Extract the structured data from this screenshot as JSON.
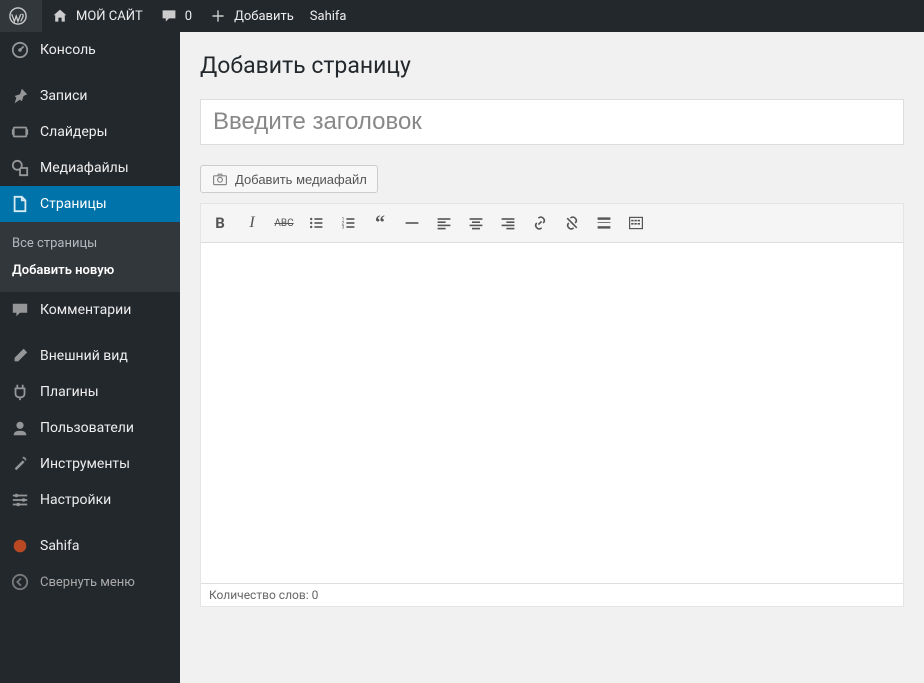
{
  "topbar": {
    "site_name": "МОЙ САЙТ",
    "comments_count": "0",
    "add_label": "Добавить",
    "theme_label": "Sahifa"
  },
  "sidebar": {
    "items": [
      {
        "label": "Консоль",
        "icon": "dashboard-icon"
      },
      {
        "label": "Записи",
        "icon": "pin-icon"
      },
      {
        "label": "Слайдеры",
        "icon": "slides-icon"
      },
      {
        "label": "Медиафайлы",
        "icon": "media-icon"
      },
      {
        "label": "Страницы",
        "icon": "page-icon",
        "active": true
      },
      {
        "label": "Комментарии",
        "icon": "comment-icon"
      },
      {
        "label": "Внешний вид",
        "icon": "brush-icon"
      },
      {
        "label": "Плагины",
        "icon": "plug-icon"
      },
      {
        "label": "Пользователи",
        "icon": "users-icon"
      },
      {
        "label": "Инструменты",
        "icon": "tools-icon"
      },
      {
        "label": "Настройки",
        "icon": "sliders-icon"
      },
      {
        "label": "Sahifa",
        "icon": "theme-icon"
      }
    ],
    "submenu": {
      "all": "Все страницы",
      "add": "Добавить новую"
    },
    "collapse": "Свернуть меню"
  },
  "main": {
    "heading": "Добавить страницу",
    "title_placeholder": "Введите заголовок",
    "media_button": "Добавить медиафайл",
    "word_count_label": "Количество слов: 0"
  },
  "toolbar_buttons": [
    "bold",
    "italic",
    "strike",
    "ul",
    "ol",
    "quote",
    "hr",
    "align-left",
    "align-center",
    "align-right",
    "link",
    "unlink",
    "readmore",
    "toolbar-toggle"
  ]
}
